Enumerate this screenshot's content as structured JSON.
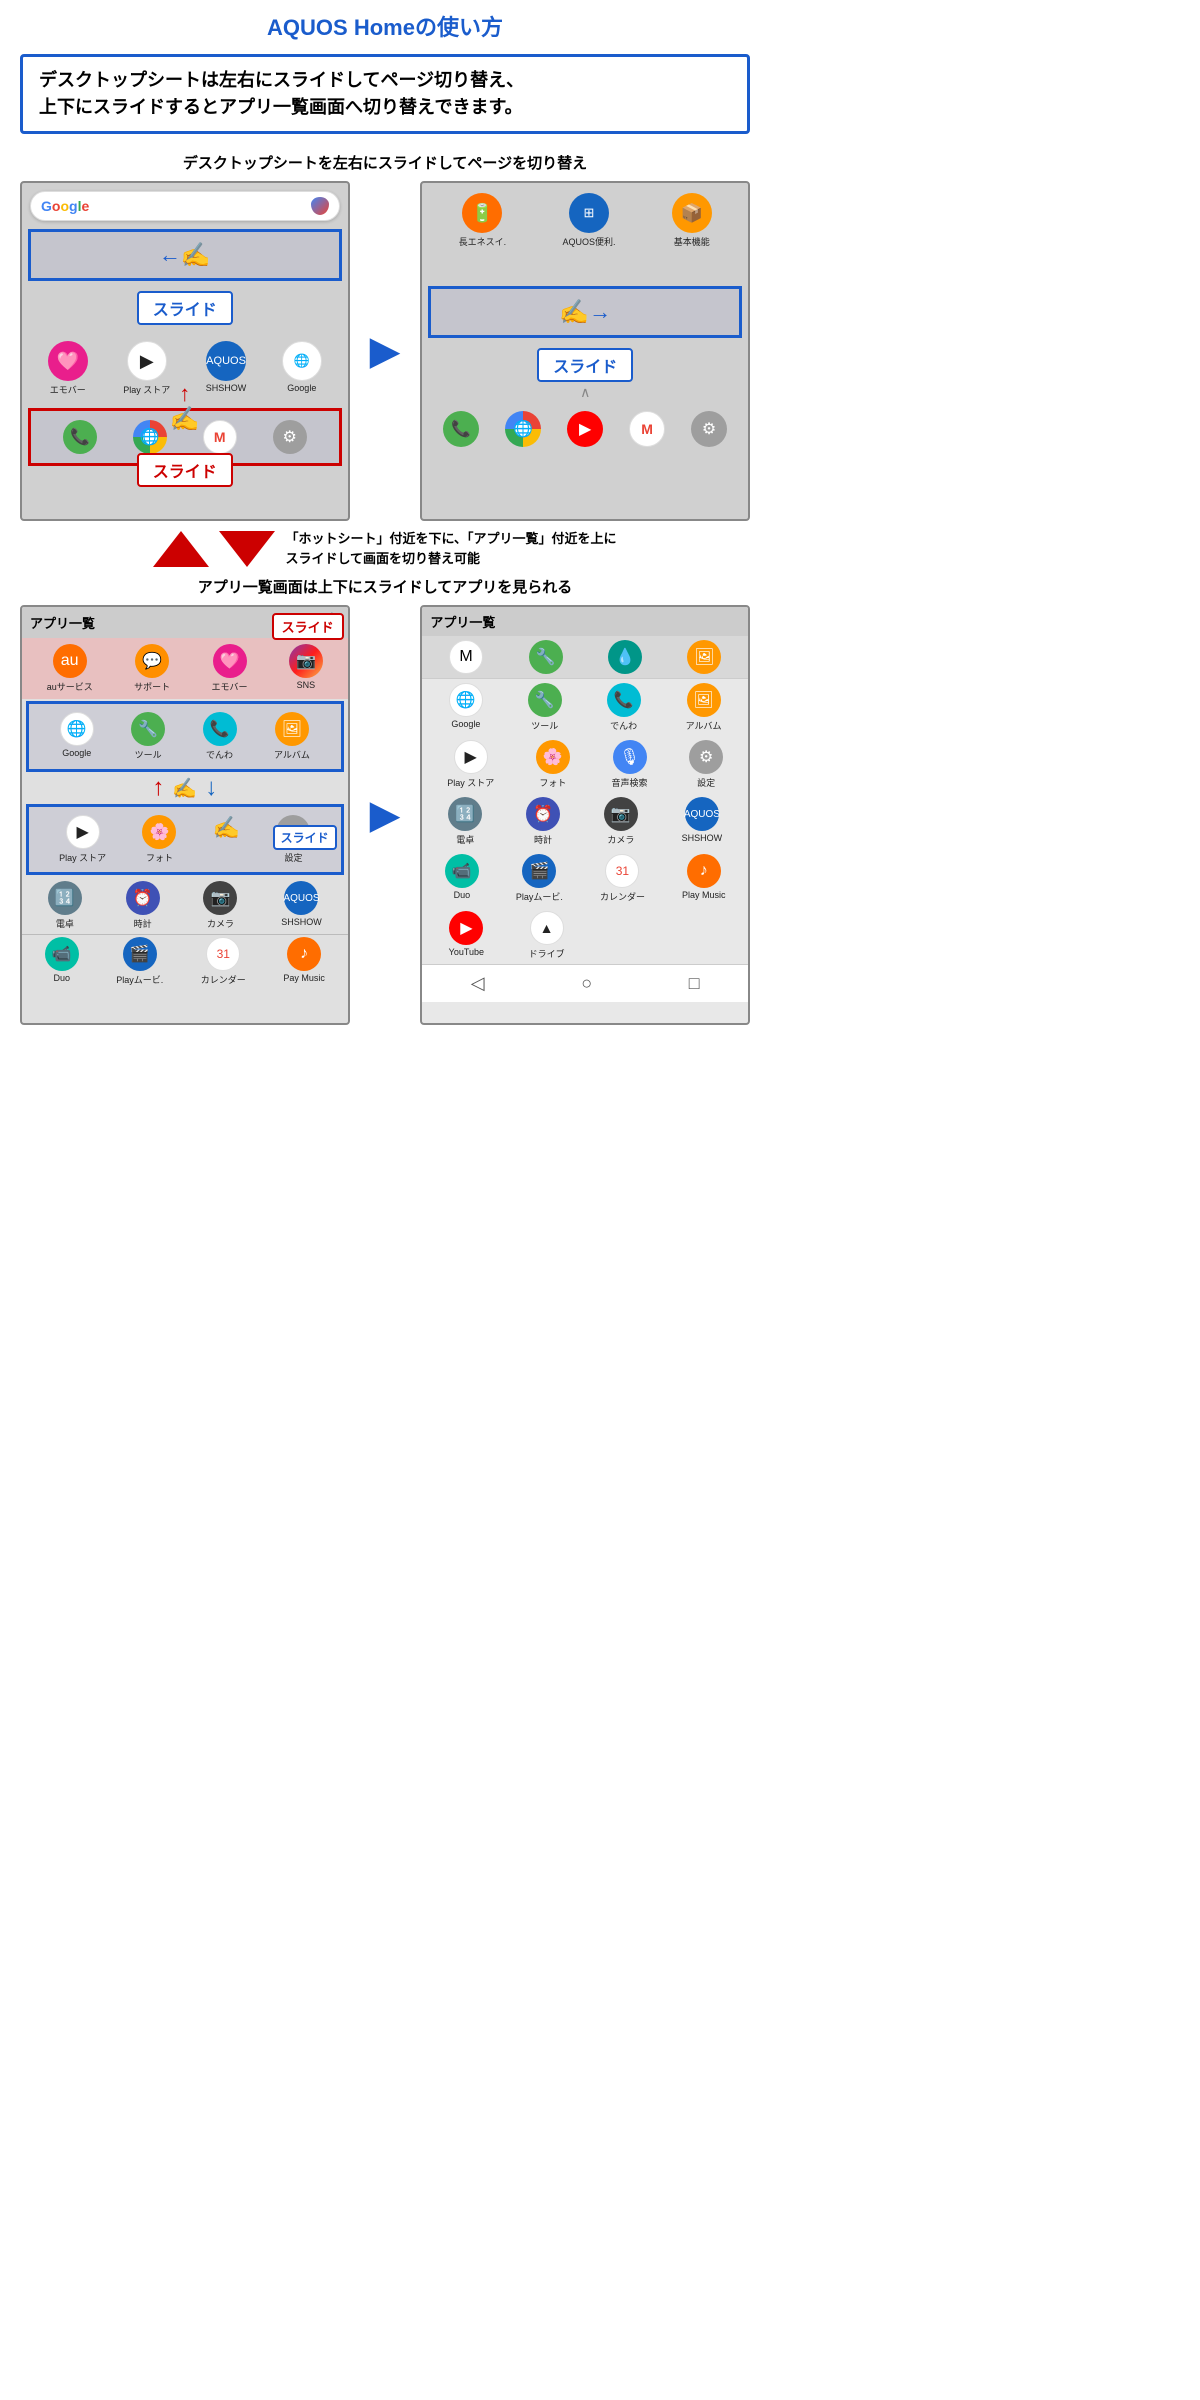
{
  "title": "AQUOS Homeの使い方",
  "notice": "デスクトップシートは左右にスライドしてページ切り替え、\n上下にスライドするとアプリ一覧画面へ切り替えできます。",
  "section1_label": "デスクトップシートを左右にスライドしてページを切り替え",
  "slide_label": "スライド",
  "arrows_text": "「ホットシート」付近を下に、「アプリ一覧」付近を上に\nスライドして画面を切り替え可能",
  "section2_label": "アプリ一覧画面は上下にスライドしてアプリを見られる",
  "app_list_label": "アプリ一覧",
  "left_screen": {
    "apps_row1": [
      "エモバー",
      "Play ストア",
      "SHSHOW",
      "Google"
    ],
    "hotsheet": [
      "電話",
      "Chrome",
      "Gmail",
      "設定"
    ]
  },
  "right_screen": {
    "top_icons": [
      "長エネスイ.",
      "AQUOS便利.",
      "基本機能"
    ],
    "hotsheet": [
      "電話",
      "Chrome",
      "YouTube",
      "Gmail",
      "設定"
    ]
  },
  "app_list_left": {
    "rows": [
      [
        "auサービス",
        "サポート",
        "エモバー",
        "SNS"
      ],
      [
        "Google",
        "ツール",
        "でんわ",
        "アルバム"
      ],
      [
        "Play ストア",
        "フォト",
        "",
        "設定"
      ],
      [
        "電卓",
        "時計",
        "カメラ",
        "SHSHOW"
      ],
      [
        "Duo",
        "Playムービ.",
        "カレンダー",
        "Pay Music"
      ]
    ]
  },
  "app_list_right": {
    "rows": [
      [
        "Google",
        "ツール",
        "でんわ",
        "アルバム"
      ],
      [
        "Play ストア",
        "フォト",
        "音声検索",
        "設定"
      ],
      [
        "電卓",
        "時計",
        "カメラ",
        "SHSHOW"
      ],
      [
        "Duo",
        "Playムービ.",
        "カレンダー",
        "Play Music"
      ],
      [
        "YouTube",
        "ドライブ",
        "",
        ""
      ]
    ]
  },
  "nav": [
    "◁",
    "○",
    "□"
  ]
}
